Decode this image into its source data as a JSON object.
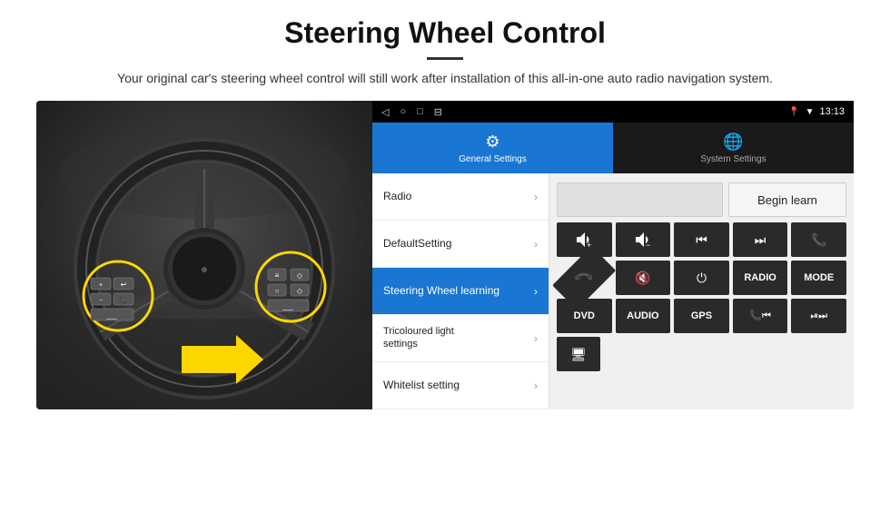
{
  "header": {
    "title": "Steering Wheel Control",
    "divider": true,
    "subtitle": "Your original car's steering wheel control will still work after installation of this all-in-one auto radio navigation system."
  },
  "status_bar": {
    "icons": [
      "◁",
      "○",
      "□",
      "⊟"
    ],
    "right_icons": [
      "📍",
      "▼"
    ],
    "time": "13:13"
  },
  "tabs": [
    {
      "label": "General Settings",
      "icon": "⚙",
      "active": true
    },
    {
      "label": "System Settings",
      "icon": "🌐",
      "active": false
    }
  ],
  "menu_items": [
    {
      "label": "Radio",
      "active": false
    },
    {
      "label": "DefaultSetting",
      "active": false
    },
    {
      "label": "Steering Wheel learning",
      "active": true
    },
    {
      "label": "Tricoloured light settings",
      "active": false
    },
    {
      "label": "Whitelist setting",
      "active": false
    }
  ],
  "radio_row": {
    "empty_box": "",
    "begin_learn_label": "Begin learn"
  },
  "ctrl_buttons_row1": [
    {
      "label": "🔊+",
      "type": "icon"
    },
    {
      "label": "🔉-",
      "type": "icon"
    },
    {
      "label": "⏮",
      "type": "icon"
    },
    {
      "label": "⏭",
      "type": "icon"
    },
    {
      "label": "📞",
      "type": "icon"
    }
  ],
  "ctrl_buttons_row2": [
    {
      "label": "📞",
      "type": "icon"
    },
    {
      "label": "🔇",
      "type": "icon"
    },
    {
      "label": "⏻",
      "type": "icon"
    },
    {
      "label": "RADIO",
      "type": "text"
    },
    {
      "label": "MODE",
      "type": "text"
    }
  ],
  "ctrl_buttons_row3": [
    {
      "label": "DVD",
      "type": "text"
    },
    {
      "label": "AUDIO",
      "type": "text"
    },
    {
      "label": "GPS",
      "type": "text"
    },
    {
      "label": "📞⏮",
      "type": "icon"
    },
    {
      "label": "⏯⏭",
      "type": "icon"
    }
  ],
  "ctrl_buttons_row4": [
    {
      "label": "🖥",
      "type": "icon"
    }
  ]
}
